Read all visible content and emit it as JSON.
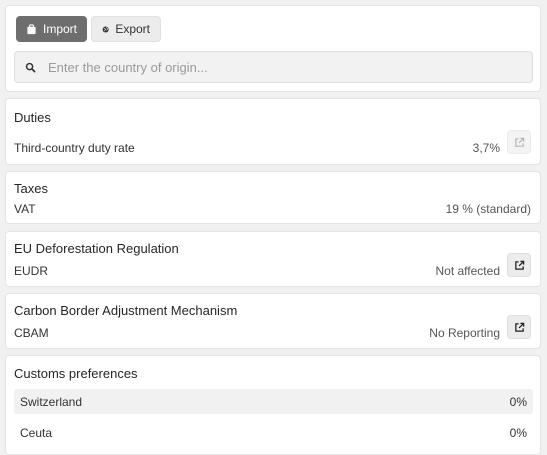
{
  "trade_toggle": {
    "import_label": "Import",
    "export_label": "Export",
    "active": "import"
  },
  "search": {
    "placeholder": "Enter the country of origin..."
  },
  "duties": {
    "title": "Duties",
    "row_label": "Third-country duty rate",
    "row_value": "3,7%",
    "link_icon": "external-link-icon"
  },
  "taxes": {
    "title": "Taxes",
    "row_label": "VAT",
    "row_value": "19 % (standard)"
  },
  "eudr": {
    "title": "EU Deforestation Regulation",
    "row_label": "EUDR",
    "row_value": "Not affected",
    "link_icon": "external-link-icon"
  },
  "cbam": {
    "title": "Carbon Border Adjustment Mechanism",
    "row_label": "CBAM",
    "row_value": "No Reporting",
    "link_icon": "external-link-icon"
  },
  "preferences": {
    "title": "Customs preferences",
    "rows": [
      {
        "country": "Switzerland",
        "rate": "0%"
      },
      {
        "country": "Ceuta",
        "rate": "0%"
      }
    ]
  },
  "colors": {
    "active_toggle": "#6e6e6e",
    "card_background": "#ffffff",
    "page_background": "#f1f1f1"
  }
}
